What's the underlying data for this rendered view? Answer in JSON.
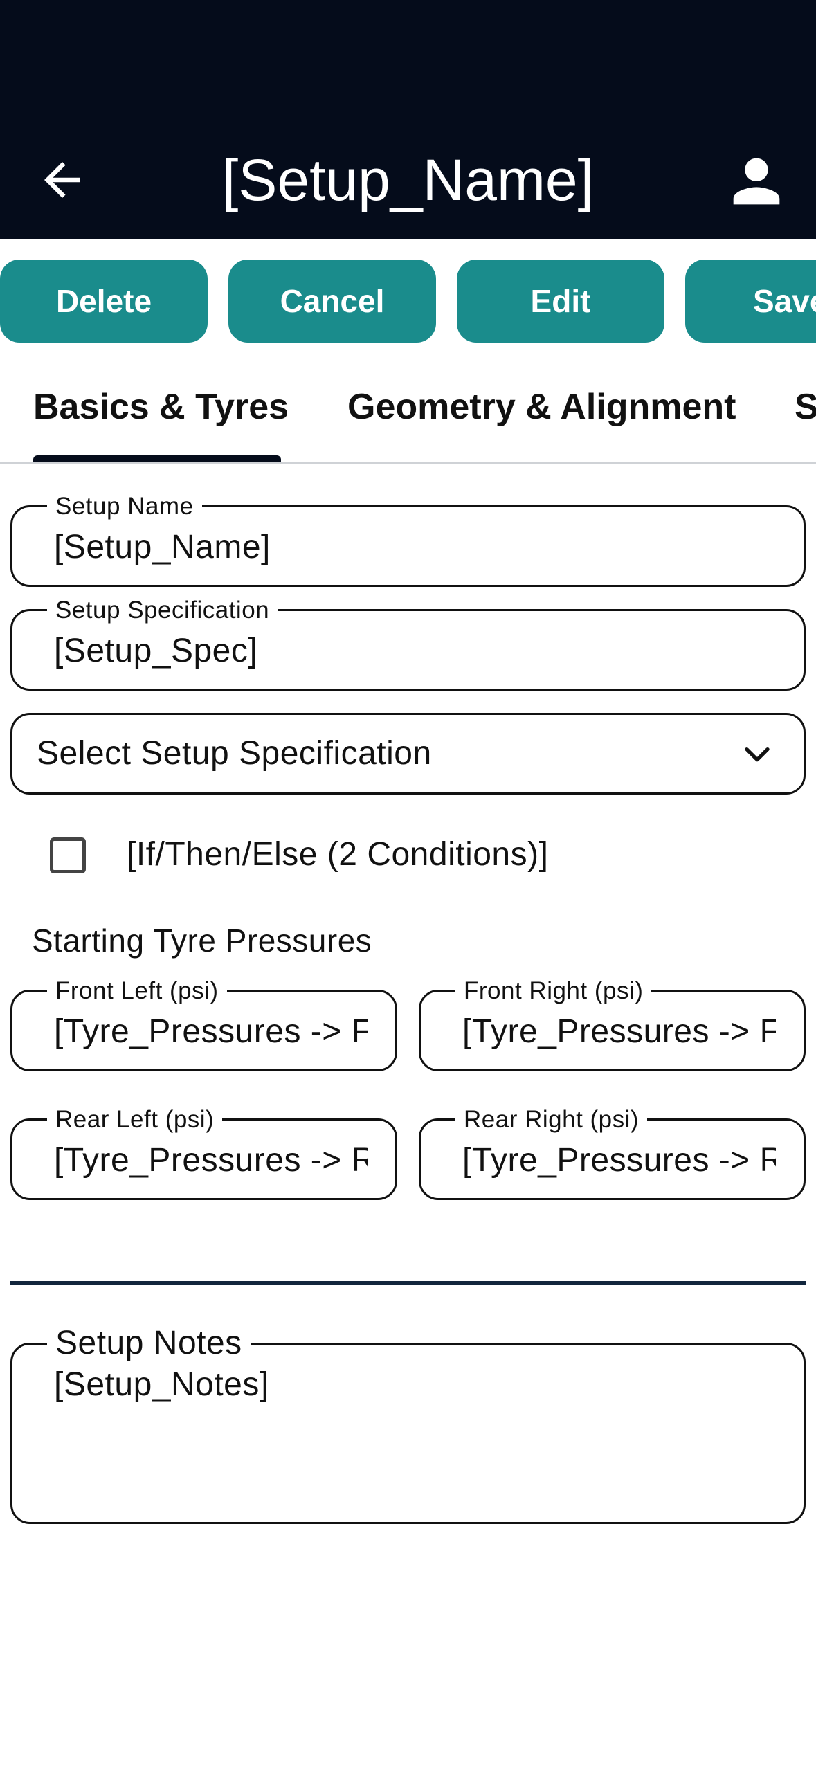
{
  "header": {
    "title": "[Setup_Name]",
    "back_icon": "arrow-left-icon",
    "profile_icon": "person-icon"
  },
  "actions": {
    "delete": "Delete",
    "cancel": "Cancel",
    "edit": "Edit",
    "save": "Save"
  },
  "tabs": [
    {
      "label": "Basics & Tyres",
      "active": true
    },
    {
      "label": "Geometry & Alignment",
      "active": false
    },
    {
      "label": "S",
      "active": false
    }
  ],
  "form": {
    "setup_name": {
      "label": "Setup Name",
      "value": "[Setup_Name]"
    },
    "setup_spec": {
      "label": "Setup Specification",
      "value": "[Setup_Spec]"
    },
    "spec_select": {
      "value": "Select Setup Specification",
      "icon": "chevron-down-icon"
    },
    "condition_checkbox": {
      "label": "[If/Then/Else (2 Conditions)]",
      "checked": false
    },
    "tyre_section_label": "Starting Tyre Pressures",
    "front_left": {
      "label": "Front Left (psi)",
      "value": "[Tyre_Pressures -> FL]"
    },
    "front_right": {
      "label": "Front Right (psi)",
      "value": "[Tyre_Pressures -> FR]"
    },
    "rear_left": {
      "label": "Rear Left (psi)",
      "value": "[Tyre_Pressures -> RL]"
    },
    "rear_right": {
      "label": "Rear Right (psi)",
      "value": "[Tyre_Pressures -> RR]"
    },
    "notes": {
      "label": "Setup Notes",
      "value": "[Setup_Notes]"
    }
  },
  "colors": {
    "appbar": "#050c1b",
    "button": "#1a8c8c",
    "divider": "#12263d"
  }
}
